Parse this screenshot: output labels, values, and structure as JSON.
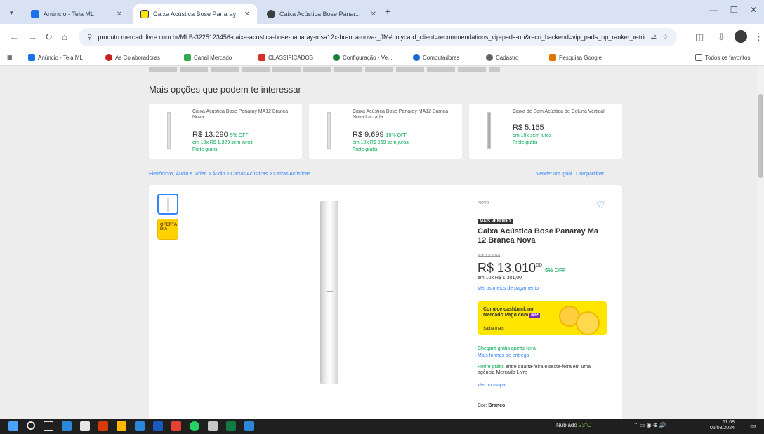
{
  "browser": {
    "tabs": [
      {
        "label": "Anúncio - Tela ML",
        "icon": "cloud-icon",
        "color": "#1a73e8"
      },
      {
        "label": "Caixa Acústica Bose Panaray",
        "icon": "mercadolivre-icon",
        "color": "#ffe600"
      },
      {
        "label": "Caixa Acústica Bose Panar...",
        "icon": "globe-icon",
        "color": "#3c4043"
      }
    ],
    "new_tab": "+",
    "url": "produto.mercadolivre.com.br/MLB-3225123456-caixa-acustica-bose-panaray-msa12x-branca-nova-_JM#polycard_client=recommendations_vip-pads-up&reco_backend=vip_pads_up_ranker_retrieval_system_odin_marketplace",
    "window_controls": [
      "—",
      "❐",
      "✕"
    ]
  },
  "bookmarks": [
    {
      "label": "Anúncio - Tela ML",
      "color": "#1a73e8"
    },
    {
      "label": "As Colaboradoras",
      "color": "#c5221f"
    },
    {
      "label": "Canal Mercado",
      "color": "#34a853"
    },
    {
      "label": "CLASSIFICADOS",
      "color": "#d93025"
    },
    {
      "label": "Configuração - Ve...",
      "color": "#188038"
    },
    {
      "label": "Computadores",
      "color": "#1967d2"
    },
    {
      "label": "Cadastro",
      "color": "#5f6368"
    },
    {
      "label": "Pesquisa Google",
      "color": "#e37400"
    }
  ],
  "bookmarks_right": "Todos os favoritos",
  "page": {
    "section_title": "Mais opções que podem te interessar",
    "cards": [
      {
        "title": "Caixa Acústica Bose Panaray MA12 Branca Nova",
        "price": "R$ 13.290",
        "discount": "5% OFF",
        "installments": "em 10x R$ 1.329 sem juros",
        "shipping": "Frete grátis"
      },
      {
        "title": "Caixa Acústica Bose Panaray MA12 Branca Nova Lacrada",
        "price": "R$ 9.699",
        "discount": "10% OFF",
        "installments": "em 10x R$ 969 sem juros",
        "shipping": "Frete grátis"
      },
      {
        "title": "Caixa de Som Acústica de Coluna Vertical",
        "price": "R$ 5.165",
        "discount": "",
        "installments": "em 10x sem juros",
        "shipping": "Frete grátis"
      }
    ],
    "breadcrumb": "Eletrônicos, Áudio e Vídeo > Áudio > Caixas Acústicas > Caixas Acústicas",
    "breadcrumb_right": "Vender um igual | Compartilhar",
    "product": {
      "condition": "Novo",
      "badge": "MAIS VENDIDO",
      "title": "Caixa Acústica Bose Panaray Ma 12 Branca Nova",
      "old_price": "R$ 13.690",
      "price": "R$ 13,010",
      "price_cents": "00",
      "discount": "5% OFF",
      "installments": "em 10x R$ 1.301,00",
      "payments_link": "Ver os meios de pagamento",
      "banner_text": "Comece cashback no Mercado Pago com",
      "banner_highlight": "MP",
      "banner_link": "Saiba mais",
      "shipping": "Chegará grátis quinta-feira",
      "shipping_link": "Mais formas de entrega",
      "pickup_green": "Retire grátis",
      "pickup_text": "entre quarta-feira e sexta-feira em uma agência Mercado Livre",
      "pickup_link": "Ver no mapa",
      "color_label": "Cor:",
      "color_value": "Branco",
      "promo_thumb": "OFERTA DIA"
    }
  },
  "taskbar": {
    "weather": "Nublado",
    "weather_temp": "23°C",
    "tray": "⌃ ▭ ◉ ⊕ 🔊",
    "time": "11:08",
    "date": "05/03/2024"
  }
}
